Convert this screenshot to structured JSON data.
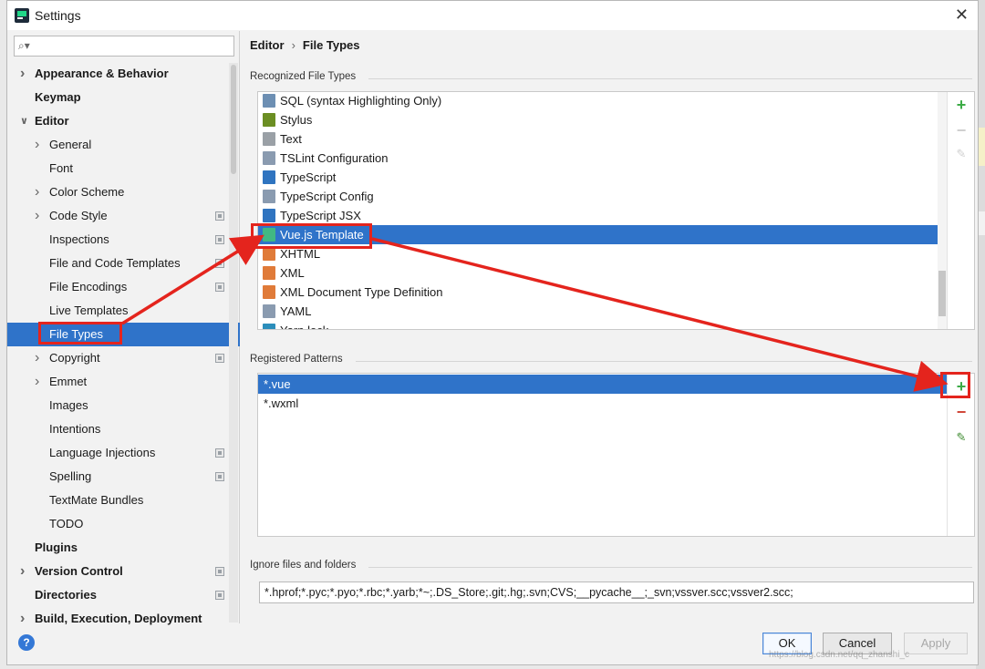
{
  "window": {
    "title": "Settings"
  },
  "search": {
    "placeholder": ""
  },
  "sidebar": {
    "items": [
      {
        "label": "Appearance & Behavior",
        "level": 0,
        "bold": true,
        "chevron": "right",
        "proj": false
      },
      {
        "label": "Keymap",
        "level": 0,
        "bold": true,
        "chevron": "none",
        "proj": false
      },
      {
        "label": "Editor",
        "level": 0,
        "bold": true,
        "chevron": "down",
        "proj": false
      },
      {
        "label": "General",
        "level": 1,
        "bold": false,
        "chevron": "right",
        "proj": false
      },
      {
        "label": "Font",
        "level": 1,
        "bold": false,
        "chevron": "none",
        "proj": false
      },
      {
        "label": "Color Scheme",
        "level": 1,
        "bold": false,
        "chevron": "right",
        "proj": false
      },
      {
        "label": "Code Style",
        "level": 1,
        "bold": false,
        "chevron": "right",
        "proj": true
      },
      {
        "label": "Inspections",
        "level": 1,
        "bold": false,
        "chevron": "none",
        "proj": true
      },
      {
        "label": "File and Code Templates",
        "level": 1,
        "bold": false,
        "chevron": "none",
        "proj": true
      },
      {
        "label": "File Encodings",
        "level": 1,
        "bold": false,
        "chevron": "none",
        "proj": true
      },
      {
        "label": "Live Templates",
        "level": 1,
        "bold": false,
        "chevron": "none",
        "proj": false
      },
      {
        "label": "File Types",
        "level": 1,
        "bold": false,
        "chevron": "none",
        "proj": false,
        "selected": true
      },
      {
        "label": "Copyright",
        "level": 1,
        "bold": false,
        "chevron": "right",
        "proj": true
      },
      {
        "label": "Emmet",
        "level": 1,
        "bold": false,
        "chevron": "right",
        "proj": false
      },
      {
        "label": "Images",
        "level": 1,
        "bold": false,
        "chevron": "none",
        "proj": false
      },
      {
        "label": "Intentions",
        "level": 1,
        "bold": false,
        "chevron": "none",
        "proj": false
      },
      {
        "label": "Language Injections",
        "level": 1,
        "bold": false,
        "chevron": "none",
        "proj": true
      },
      {
        "label": "Spelling",
        "level": 1,
        "bold": false,
        "chevron": "none",
        "proj": true
      },
      {
        "label": "TextMate Bundles",
        "level": 1,
        "bold": false,
        "chevron": "none",
        "proj": false
      },
      {
        "label": "TODO",
        "level": 1,
        "bold": false,
        "chevron": "none",
        "proj": false
      },
      {
        "label": "Plugins",
        "level": 0,
        "bold": true,
        "chevron": "none",
        "proj": false
      },
      {
        "label": "Version Control",
        "level": 0,
        "bold": true,
        "chevron": "right",
        "proj": true
      },
      {
        "label": "Directories",
        "level": 0,
        "bold": true,
        "chevron": "none",
        "proj": true
      },
      {
        "label": "Build, Execution, Deployment",
        "level": 0,
        "bold": true,
        "chevron": "right",
        "proj": false
      }
    ]
  },
  "breadcrumb": {
    "parent": "Editor",
    "separator": "›",
    "current": "File Types"
  },
  "recognized": {
    "label": "Recognized File Types",
    "items": [
      {
        "label": "SQL (syntax Highlighting Only)",
        "icon": "sql-file-icon",
        "color": "#6d8fb3"
      },
      {
        "label": "Stylus",
        "icon": "stylus-file-icon",
        "color": "#6b8e23"
      },
      {
        "label": "Text",
        "icon": "text-file-icon",
        "color": "#9aa0a6"
      },
      {
        "label": "TSLint Configuration",
        "icon": "config-file-icon",
        "color": "#8a9bb0"
      },
      {
        "label": "TypeScript",
        "icon": "typescript-file-icon",
        "color": "#2f74c0"
      },
      {
        "label": "TypeScript Config",
        "icon": "config-file-icon",
        "color": "#8a9bb0"
      },
      {
        "label": "TypeScript JSX",
        "icon": "tsx-file-icon",
        "color": "#2f74c0"
      },
      {
        "label": "Vue.js Template",
        "icon": "vue-file-icon",
        "color": "#41b883",
        "selected": true
      },
      {
        "label": "XHTML",
        "icon": "xhtml-file-icon",
        "color": "#e07b39"
      },
      {
        "label": "XML",
        "icon": "xml-file-icon",
        "color": "#e07b39"
      },
      {
        "label": "XML Document Type Definition",
        "icon": "dtd-file-icon",
        "color": "#e07b39"
      },
      {
        "label": "YAML",
        "icon": "yaml-file-icon",
        "color": "#8a9bb0"
      },
      {
        "label": "Yarn.lock",
        "icon": "yarn-file-icon",
        "color": "#2c8ebb"
      }
    ]
  },
  "patterns": {
    "label": "Registered Patterns",
    "items": [
      {
        "label": "*.vue",
        "selected": true
      },
      {
        "label": "*.wxml",
        "selected": false
      }
    ]
  },
  "ignore": {
    "label": "Ignore files and folders",
    "value": "*.hprof;*.pyc;*.pyo;*.rbc;*.yarb;*~;.DS_Store;.git;.hg;.svn;CVS;__pycache__;_svn;vssver.scc;vssver2.scc;"
  },
  "tools": {
    "plus": "+",
    "minus": "−",
    "edit": "✎"
  },
  "buttons": {
    "help": "?",
    "ok": "OK",
    "cancel": "Cancel",
    "apply": "Apply"
  },
  "watermark": "https://blog.csdn.net/qq_zhanshi_c",
  "colors": {
    "selection": "#2f73c9",
    "annotation": "#e4241d",
    "add": "#3cab46",
    "remove": "#d04537"
  }
}
